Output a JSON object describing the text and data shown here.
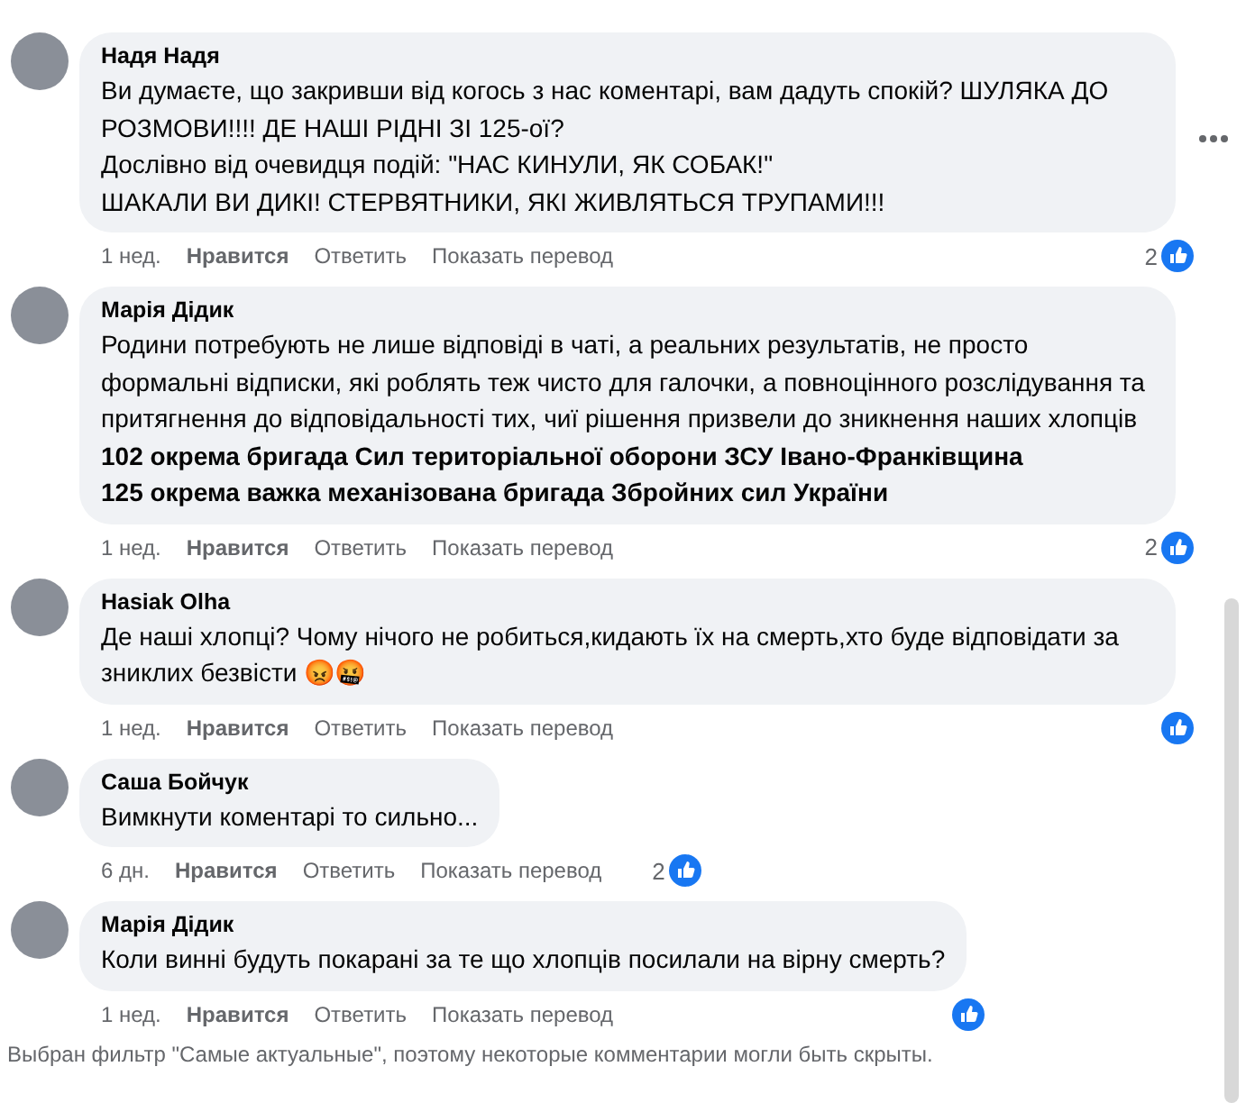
{
  "comments": [
    {
      "author": "Надя Надя",
      "more_button": true,
      "paragraphs": [
        {
          "text": "Ви думаєте, що закривши від когось з нас коментарі, вам дадуть спокій? ШУЛЯКА ДО РОЗМОВИ!!!! ДЕ НАШІ РІДНІ ЗІ 125-ої?",
          "bold": false
        },
        {
          "text": "Дослівно від очевидця подій: \"НАС КИНУЛИ, ЯК СОБАК!\"",
          "bold": false
        },
        {
          "text": "ШАКАЛИ ВИ ДИКІ! СТЕРВЯТНИКИ, ЯКІ ЖИВЛЯТЬСЯ ТРУПАМИ!!!",
          "bold": false
        }
      ],
      "time": "1 нед.",
      "actions": [
        "Нравится",
        "Ответить",
        "Показать перевод"
      ],
      "likes": "2"
    },
    {
      "author": "Марія Дідик",
      "more_button": false,
      "paragraphs": [
        {
          "text": "Родини потребують не лише відповіді в чаті, а реальних результатів, не просто формальні відписки, які роблять теж чисто для галочки, а повноцінного розслідування та притягнення до відповідальності тих, чиї рішення призвели до зникнення наших хлопців",
          "bold": false
        },
        {
          "text": "102 окрема бригада Сил територіальної оборони ЗСУ Івано-Франківщина",
          "bold": true
        },
        {
          "text": "125 окрема важка механізована бригада Збройних сил України",
          "bold": true
        }
      ],
      "time": "1 нед.",
      "actions": [
        "Нравится",
        "Ответить",
        "Показать перевод"
      ],
      "likes": "2"
    },
    {
      "author": "Hasiak Olha",
      "more_button": false,
      "paragraphs": [
        {
          "text": "Де наші хлопці? Чому нічого не робиться,кидають їх на смерть,хто буде відповідати за зниклих безвісти 😡🤬",
          "bold": false
        }
      ],
      "time": "1 нед.",
      "actions": [
        "Нравится",
        "Ответить",
        "Показать перевод"
      ]
    },
    {
      "author": "Саша Бойчук",
      "more_button": false,
      "paragraphs": [
        {
          "text": "Вимкнути коментарі то сильно...",
          "bold": false
        }
      ],
      "time": "6 дн.",
      "actions": [
        "Нравится",
        "Ответить",
        "Показать перевод"
      ],
      "likes": "2"
    },
    {
      "author": "Марія Дідик",
      "more_button": false,
      "paragraphs": [
        {
          "text": "Коли винні будуть покарані за те що хлопців посилали на вірну смерть?",
          "bold": false
        }
      ],
      "time": "1 нед.",
      "actions": [
        "Нравится",
        "Ответить",
        "Показать перевод"
      ]
    }
  ],
  "footer_note": "Выбран фильтр \"Самые актуальные\", поэтому некоторые комментарии могли быть скрыты."
}
